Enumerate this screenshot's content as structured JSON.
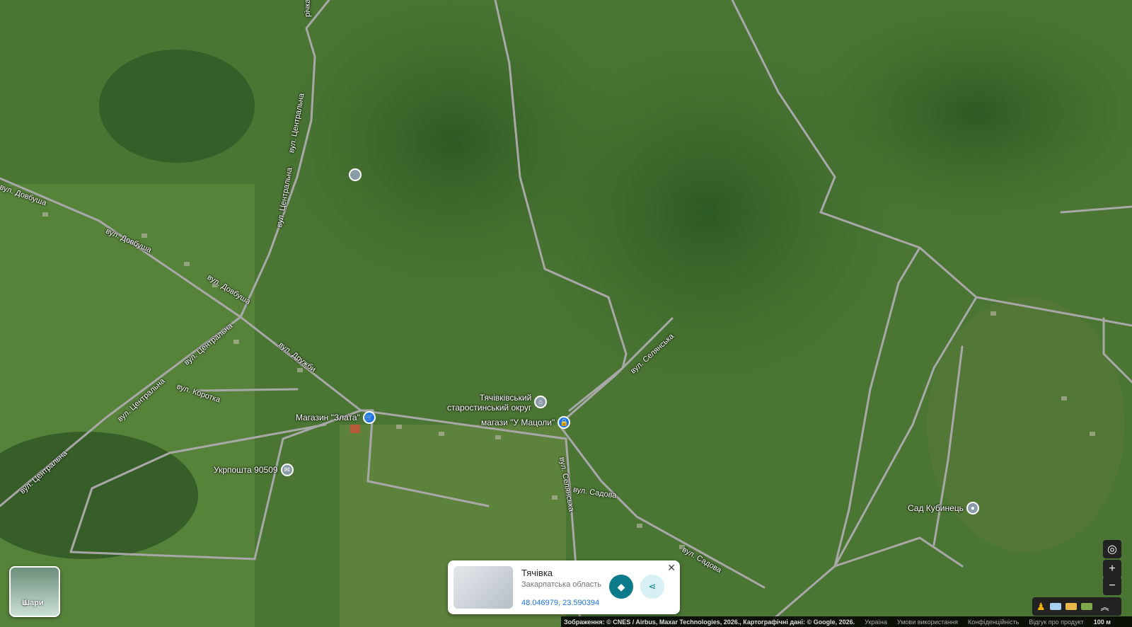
{
  "map": {
    "streets": {
      "dovbusha_1": "вул. Довбуша",
      "dovbusha_2": "вул. Довбуша",
      "dovbusha_3": "вул. Довбуша",
      "tsentralna_1": "вул. Центральна",
      "tsentralna_2": "вул. Центральна",
      "tsentralna_3": "вул. Центральна",
      "tsentralna_4": "вул. Центральна",
      "tsentralna_5": "вул. Центральна",
      "druzhby": "вул. Дружби",
      "korotka": "вул. Коротка",
      "selianska_1": "вул. Селянська",
      "selianska_2": "вул. Селянська",
      "sadova_1": "вул. Садова",
      "sadova_2": "вул. Садова",
      "richka": "річка"
    },
    "pois": {
      "zlata": "Магазин \"Злата\"",
      "starostat_line1": "Тячівківський",
      "starostat_line2": "старостинський округ",
      "u_matsoly": "магази \"У Мацоли\"",
      "ukrposhta": "Укрпошта 90509",
      "sad": "Сад Кубинець"
    }
  },
  "layers": {
    "label": "Шари"
  },
  "place_card": {
    "title": "Тячівка",
    "subtitle": "Закарпатська область",
    "coordinates": "48.046979, 23.590394",
    "close_glyph": "✕",
    "directions_glyph": "◆",
    "share_glyph": "⋖"
  },
  "controls": {
    "locate": "◎",
    "zoom_in": "+",
    "zoom_out": "−",
    "expand": "︽"
  },
  "footer": {
    "attribution": "Зображення: © CNES / Airbus, Maxar Technologies, 2026., Картографічні дані: © Google, 2026.",
    "country": "Україна",
    "terms": "Умови використання",
    "privacy": "Конфіденційність",
    "feedback": "Відгук про продукт",
    "scale": "100 м"
  },
  "colors": {
    "accent": "#1a73e8",
    "directions": "#0b7a8a"
  }
}
